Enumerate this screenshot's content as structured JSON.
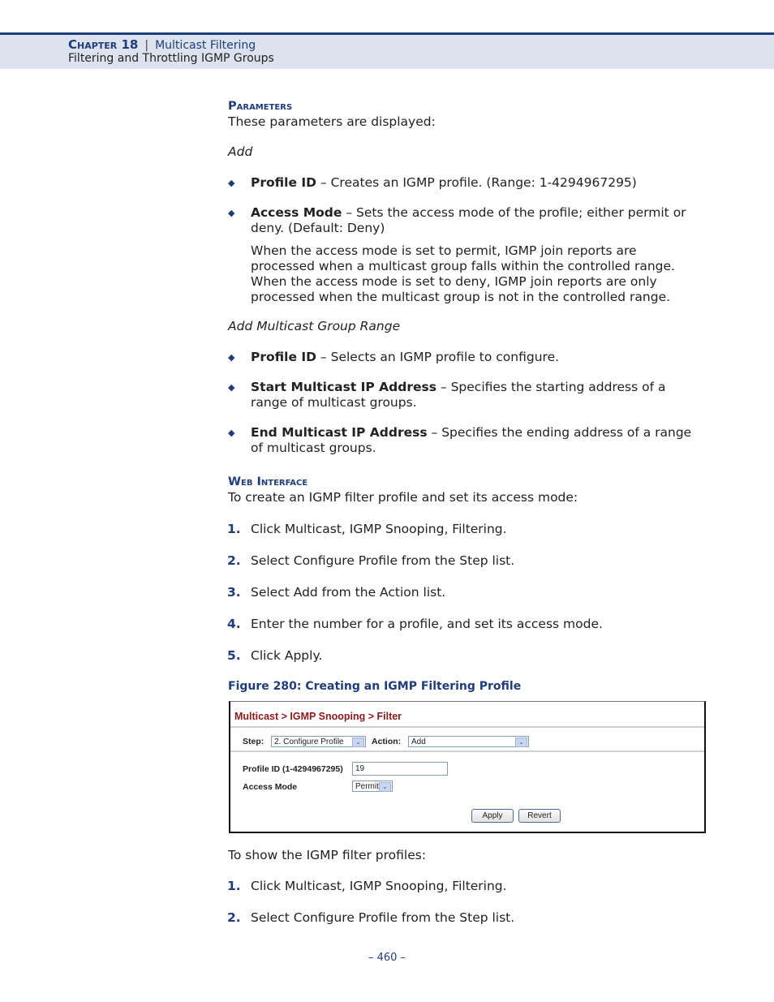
{
  "header": {
    "chapter": "Chapter 18",
    "separator": "|",
    "chapter_title": "Multicast Filtering",
    "section_title": "Filtering and Throttling IGMP Groups"
  },
  "parameters": {
    "heading": "Parameters",
    "intro": "These parameters are displayed:",
    "add_heading": "Add",
    "add_items": [
      {
        "term": "Profile ID",
        "desc": " – Creates an IGMP profile. (Range: 1-4294967295)"
      },
      {
        "term": "Access Mode",
        "desc": " – Sets the access mode of the profile; either permit or deny. (Default: Deny)",
        "note": "When the access mode is set to permit, IGMP join reports are processed when a multicast group falls within the controlled range. When the access mode is set to deny, IGMP join reports are only processed when the multicast group is not in the controlled range."
      }
    ],
    "range_heading": "Add Multicast Group Range",
    "range_items": [
      {
        "term": "Profile ID",
        "desc": " – Selects an IGMP profile to configure."
      },
      {
        "term": "Start Multicast IP Address",
        "desc": " – Specifies the starting address of a range of multicast groups."
      },
      {
        "term": "End Multicast IP Address",
        "desc": " – Specifies the ending address of a range of multicast groups."
      }
    ]
  },
  "web_interface": {
    "heading": "Web Interface",
    "intro": "To create an IGMP filter profile and set its access mode:",
    "steps": [
      {
        "num": "1.",
        "text": "Click Multicast, IGMP Snooping, Filtering."
      },
      {
        "num": "2.",
        "text": "Select Configure Profile from the Step list."
      },
      {
        "num": "3.",
        "text": "Select Add from the Action list."
      },
      {
        "num": "4.",
        "text": "Enter the number for a profile, and set its access mode."
      },
      {
        "num": "5.",
        "text": "Click Apply."
      }
    ],
    "figure_caption": "Figure 280:  Creating an IGMP Filtering Profile",
    "show_intro": "To show the IGMP filter profiles:",
    "show_steps": [
      {
        "num": "1.",
        "text": "Click Multicast, IGMP Snooping, Filtering."
      },
      {
        "num": "2.",
        "text": "Select Configure Profile from the Step list."
      }
    ]
  },
  "figure": {
    "breadcrumb": "Multicast > IGMP Snooping > Filter",
    "step_label": "Step:",
    "step_value": "2. Configure Profile",
    "action_label": "Action:",
    "action_value": "Add",
    "profile_id_label": "Profile ID (1-4294967295)",
    "profile_id_value": "19",
    "access_mode_label": "Access Mode",
    "access_mode_value": "Permit",
    "apply_label": "Apply",
    "revert_label": "Revert",
    "dropdown_glyph": "⌄"
  },
  "footer": {
    "page_number": "–  460  –"
  }
}
